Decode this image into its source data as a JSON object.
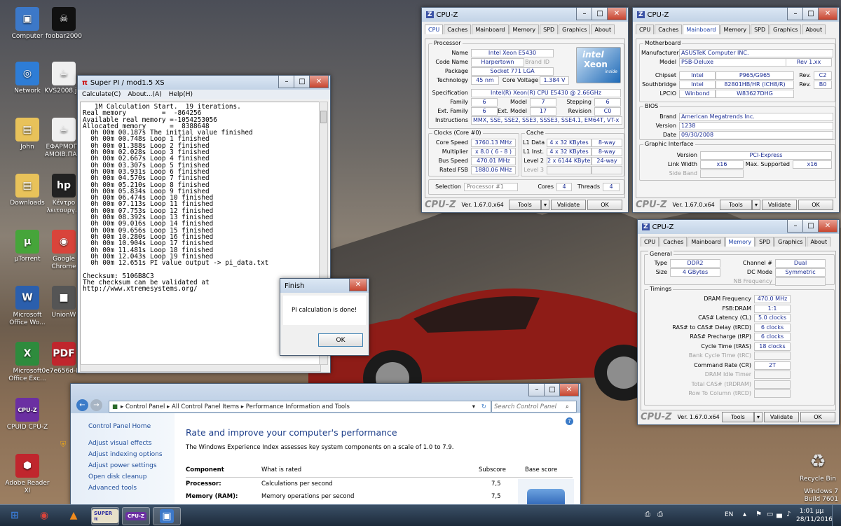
{
  "desktop_icons": [
    {
      "label": "Computer",
      "glyph": "▣",
      "color": "#3c78c8"
    },
    {
      "label": "foobar2000",
      "glyph": "☠",
      "color": "#111"
    },
    {
      "label": "Network",
      "glyph": "◎",
      "color": "#2e7dd6"
    },
    {
      "label": "KVS2008.jar",
      "glyph": "☕",
      "color": "#f0f0f0"
    },
    {
      "label": "John",
      "glyph": "▤",
      "color": "#e8c25a"
    },
    {
      "label": "ΕΦΑΡΜΟΓΗ ΑΜΟΙΒ.ΠΑ...",
      "glyph": "☕",
      "color": "#f0f0f0"
    },
    {
      "label": "Downloads",
      "glyph": "▤",
      "color": "#e8c25a"
    },
    {
      "label": "Κέντρο λειτουργ...",
      "glyph": "hp",
      "color": "#222"
    },
    {
      "label": "µTorrent",
      "glyph": "µ",
      "color": "#46a53a"
    },
    {
      "label": "Google Chrome",
      "glyph": "◉",
      "color": "#d9443b"
    },
    {
      "label": "Microsoft Office Wo...",
      "glyph": "W",
      "color": "#2b5fad"
    },
    {
      "label": "UnionW",
      "glyph": "■",
      "color": "#555"
    },
    {
      "label": "Microsoft Office Exc...",
      "glyph": "X",
      "color": "#2e8b3d"
    },
    {
      "label": "0e7e656d-b...",
      "glyph": "PDF",
      "color": "#c0262d"
    },
    {
      "label": "CPUID CPU-Z",
      "glyph": "CPU-Z",
      "color": "#6b2fa2"
    },
    {
      "label": "Adobe Reader XI",
      "glyph": "⬢",
      "color": "#c0262d"
    }
  ],
  "recycle": {
    "label": "Recycle Bin"
  },
  "watermark": {
    "line1": "Windows 7",
    "line2": "Build 7601"
  },
  "superpi": {
    "title": "Super PI / mod1.5 XS",
    "menu": [
      "Calculate(C)",
      "About...(A)",
      "Help(H)"
    ],
    "lines": [
      "   1M Calculation Start.  19 iterations.",
      "Real memory         =  -864256",
      "Available real memory =-1054253056",
      "Allocated memory      =  8388648",
      "  0h 00m 00.187s The initial value finished",
      "  0h 00m 00.748s Loop 1 finished",
      "  0h 00m 01.388s Loop 2 finished",
      "  0h 00m 02.028s Loop 3 finished",
      "  0h 00m 02.667s Loop 4 finished",
      "  0h 00m 03.307s Loop 5 finished",
      "  0h 00m 03.931s Loop 6 finished",
      "  0h 00m 04.570s Loop 7 finished",
      "  0h 00m 05.210s Loop 8 finished",
      "  0h 00m 05.834s Loop 9 finished",
      "  0h 00m 06.474s Loop 10 finished",
      "  0h 00m 07.113s Loop 11 finished",
      "  0h 00m 07.753s Loop 12 finished",
      "  0h 00m 08.392s Loop 13 finished",
      "  0h 00m 09.016s Loop 14 finished",
      "  0h 00m 09.656s Loop 15 finished",
      "  0h 00m 10.280s Loop 16 finished",
      "  0h 00m 10.904s Loop 17 finished",
      "  0h 00m 11.481s Loop 18 finished",
      "  0h 00m 12.043s Loop 19 finished",
      "  0h 00m 12.651s PI value output -> pi_data.txt",
      "",
      "Checksum: 5106B8C3",
      "The checksum can be validated at",
      "http://www.xtremesystems.org/"
    ]
  },
  "finish": {
    "title": "Finish",
    "message": "PI calculation is done!",
    "ok": "OK"
  },
  "cpuz_tabs": [
    "CPU",
    "Caches",
    "Mainboard",
    "Memory",
    "SPD",
    "Graphics",
    "About"
  ],
  "cpuz_common": {
    "title": "CPU-Z",
    "logo": "CPU-Z",
    "tools": "Tools",
    "validate": "Validate",
    "ok": "OK"
  },
  "cpuz1": {
    "version": "Ver. 1.67.0.x64",
    "processor_label": "Processor",
    "name": {
      "label": "Name",
      "value": "Intel Xeon E5430"
    },
    "codename": {
      "label": "Code Name",
      "value": "Harpertown",
      "brand_label": "Brand ID"
    },
    "package": {
      "label": "Package",
      "value": "Socket 771 LGA"
    },
    "technology": {
      "label": "Technology",
      "value": "45 nm",
      "cv_label": "Core Voltage",
      "cv_value": "1.384 V"
    },
    "spec": {
      "label": "Specification",
      "value": "Intel(R) Xeon(R) CPU        E5430  @ 2.66GHz"
    },
    "family": {
      "label": "Family",
      "value": "6",
      "model_label": "Model",
      "model_value": "7",
      "stepping_label": "Stepping",
      "stepping_value": "6"
    },
    "extfamily": {
      "label": "Ext. Family",
      "value": "6",
      "extmodel_label": "Ext. Model",
      "extmodel_value": "17",
      "revision_label": "Revision",
      "revision_value": "C0"
    },
    "instructions": {
      "label": "Instructions",
      "value": "MMX, SSE, SSE2, SSE3, SSSE3, SSE4.1, EM64T, VT-x"
    },
    "clocks_label": "Clocks (Core #0)",
    "corespeed": {
      "label": "Core Speed",
      "value": "3760.13 MHz"
    },
    "multiplier": {
      "label": "Multiplier",
      "value": "x 8.0 ( 6 - 8 )"
    },
    "busspeed": {
      "label": "Bus Speed",
      "value": "470.01 MHz"
    },
    "ratedfsb": {
      "label": "Rated FSB",
      "value": "1880.06 MHz"
    },
    "cache_label": "Cache",
    "l1data": {
      "label": "L1 Data",
      "value": "4 x 32 KBytes",
      "way": "8-way"
    },
    "l1inst": {
      "label": "L1 Inst.",
      "value": "4 x 32 KBytes",
      "way": "8-way"
    },
    "level2": {
      "label": "Level 2",
      "value": "2 x 6144 KBytes",
      "way": "24-way"
    },
    "level3": {
      "label": "Level 3"
    },
    "selection": {
      "label": "Selection",
      "value": "Processor #1",
      "cores_label": "Cores",
      "cores": "4",
      "threads_label": "Threads",
      "threads": "4"
    },
    "badge": {
      "brand": "intel",
      "line": "Xeon",
      "tag": "inside"
    }
  },
  "cpuz2": {
    "version": "Ver. 1.67.0.x64",
    "mb_label": "Motherboard",
    "manufacturer": {
      "label": "Manufacturer",
      "value": "ASUSTeK Computer INC."
    },
    "model": {
      "label": "Model",
      "value": "P5B-Deluxe",
      "rev": "Rev 1.xx"
    },
    "chipset": {
      "label": "Chipset",
      "vendor": "Intel",
      "value": "P965/G965",
      "rev_label": "Rev.",
      "rev": "C2"
    },
    "southbridge": {
      "label": "Southbridge",
      "vendor": "Intel",
      "value": "82801HB/HR (ICH8/R)",
      "rev_label": "Rev.",
      "rev": "B0"
    },
    "lpcio": {
      "label": "LPCIO",
      "vendor": "Winbond",
      "value": "W83627DHG"
    },
    "bios_label": "BIOS",
    "brand": {
      "label": "Brand",
      "value": "American Megatrends Inc."
    },
    "bversion": {
      "label": "Version",
      "value": "1238"
    },
    "bdate": {
      "label": "Date",
      "value": "09/30/2008"
    },
    "gi_label": "Graphic Interface",
    "gversion": {
      "label": "Version",
      "value": "PCI-Express"
    },
    "linkwidth": {
      "label": "Link Width",
      "value": "x16",
      "max_label": "Max. Supported",
      "max": "x16"
    },
    "sideband": {
      "label": "Side Band"
    }
  },
  "cpuz3": {
    "version": "Ver. 1.67.0.x64",
    "general_label": "General",
    "type": {
      "label": "Type",
      "value": "DDR2",
      "ch_label": "Channel #",
      "ch": "Dual"
    },
    "size": {
      "label": "Size",
      "value": "4 GBytes",
      "dc_label": "DC Mode",
      "dc": "Symmetric"
    },
    "nb": {
      "label": "NB Frequency"
    },
    "timings_label": "Timings",
    "timings": [
      {
        "label": "DRAM Frequency",
        "value": "470.0 MHz",
        "dis": false
      },
      {
        "label": "FSB:DRAM",
        "value": "1:1",
        "dis": false
      },
      {
        "label": "CAS# Latency (CL)",
        "value": "5.0 clocks",
        "dis": false
      },
      {
        "label": "RAS# to CAS# Delay (tRCD)",
        "value": "6 clocks",
        "dis": false
      },
      {
        "label": "RAS# Precharge (tRP)",
        "value": "6 clocks",
        "dis": false
      },
      {
        "label": "Cycle Time (tRAS)",
        "value": "18 clocks",
        "dis": false
      },
      {
        "label": "Bank Cycle Time (tRC)",
        "value": "",
        "dis": true
      },
      {
        "label": "Command Rate (CR)",
        "value": "2T",
        "dis": false
      },
      {
        "label": "DRAM Idle Timer",
        "value": "",
        "dis": true
      },
      {
        "label": "Total CAS# (tRDRAM)",
        "value": "",
        "dis": true
      },
      {
        "label": "Row To Column (tRCD)",
        "value": "",
        "dis": true
      }
    ]
  },
  "controlpanel": {
    "breadcrumb": [
      "Control Panel",
      "All Control Panel Items",
      "Performance Information and Tools"
    ],
    "search_placeholder": "Search Control Panel",
    "side_home": "Control Panel Home",
    "side_links": [
      "Adjust visual effects",
      "Adjust indexing options",
      "Adjust power settings",
      "Open disk cleanup",
      "Advanced tools"
    ],
    "heading": "Rate and improve your computer's performance",
    "intro": "The Windows Experience Index assesses key system components on a scale of 1.0 to 7.9.",
    "columns": [
      "Component",
      "What is rated",
      "Subscore",
      "Base score"
    ],
    "rows": [
      {
        "component": "Processor:",
        "rated": "Calculations per second",
        "score": "7,5"
      },
      {
        "component": "Memory (RAM):",
        "rated": "Memory operations per second",
        "score": "7,5"
      }
    ]
  },
  "taskbar": {
    "lang": "EN",
    "time": "1:01 μμ",
    "date": "28/11/2016",
    "items": [
      {
        "name": "start",
        "glyph": "⊞",
        "color": "#3a7bd5"
      },
      {
        "name": "chrome",
        "glyph": "◉",
        "color": "#d9443b"
      },
      {
        "name": "vlc",
        "glyph": "▲",
        "color": "#f08a1c"
      },
      {
        "name": "superpi",
        "glyph": "SUPER π",
        "color": "#e7e0c9"
      },
      {
        "name": "cpuz",
        "glyph": "CPU-Z",
        "color": "#6b2fa2"
      },
      {
        "name": "controlpanel",
        "glyph": "▣",
        "color": "#3c78c8"
      }
    ]
  }
}
